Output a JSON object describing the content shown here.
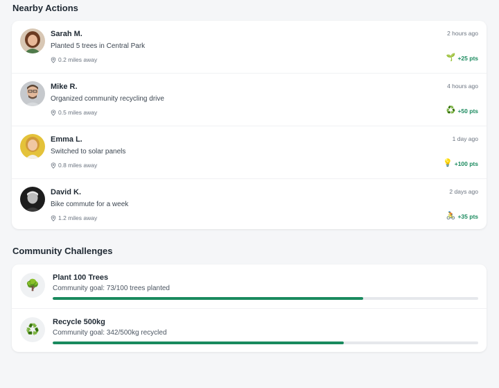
{
  "nearby": {
    "title": "Nearby Actions",
    "items": [
      {
        "name": "Sarah M.",
        "action": "Planted 5 trees in Central Park",
        "distance": "0.2 miles away",
        "time": "2 hours ago",
        "points": "+25 pts",
        "icon": "🌱",
        "icon_name": "seedling-icon",
        "avatar_bg": "#c9a98a"
      },
      {
        "name": "Mike R.",
        "action": "Organized community recycling drive",
        "distance": "0.5 miles away",
        "time": "4 hours ago",
        "points": "+50 pts",
        "icon": "♻️",
        "icon_name": "recycle-icon",
        "avatar_bg": "#b8bcc2"
      },
      {
        "name": "Emma L.",
        "action": "Switched to solar panels",
        "distance": "0.8 miles away",
        "time": "1 day ago",
        "points": "+100 pts",
        "icon": "💡",
        "icon_name": "lightbulb-icon",
        "avatar_bg": "#e4c23a"
      },
      {
        "name": "David K.",
        "action": "Bike commute for a week",
        "distance": "1.2 miles away",
        "time": "2 days ago",
        "points": "+35 pts",
        "icon": "🚴",
        "icon_name": "bicycle-icon",
        "avatar_bg": "#1d1d1d"
      }
    ]
  },
  "challenges": {
    "title": "Community Challenges",
    "items": [
      {
        "title": "Plant 100 Trees",
        "subtitle": "Community goal: 73/100 trees planted",
        "progress": 0.73,
        "icon": "🌳",
        "icon_name": "tree-icon"
      },
      {
        "title": "Recycle 500kg",
        "subtitle": "Community goal: 342/500kg recycled",
        "progress": 0.684,
        "icon": "♻️",
        "icon_name": "recycle-icon"
      }
    ]
  },
  "colors": {
    "accent": "#1a8a5e",
    "bar_track": "#e6e8ec"
  }
}
